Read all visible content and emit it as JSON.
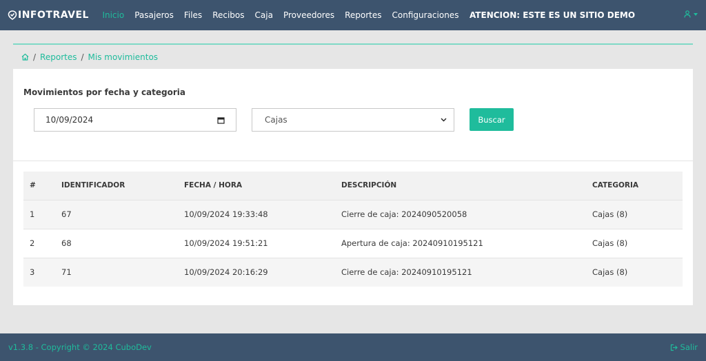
{
  "brand": {
    "name": "INFOTRAVEL"
  },
  "nav": {
    "items": [
      "Inicio",
      "Pasajeros",
      "Files",
      "Recibos",
      "Caja",
      "Proveedores",
      "Reportes",
      "Configuraciones"
    ],
    "warning": "ATENCION: ESTE ES UN SITIO DEMO"
  },
  "breadcrumb": {
    "items": [
      "Reportes",
      "Mis movimientos"
    ]
  },
  "panel": {
    "title": "Movimientos por fecha y categoria",
    "date_value": "10/09/2024",
    "category_value": "Cajas",
    "search_label": "Buscar"
  },
  "table": {
    "headers": [
      "#",
      "IDENTIFICADOR",
      "FECHA / HORA",
      "DESCRIPCIÓN",
      "CATEGORIA"
    ],
    "rows": [
      [
        "1",
        "67",
        "10/09/2024 19:33:48",
        "Cierre de caja: 2024090520058",
        "Cajas (8)"
      ],
      [
        "2",
        "68",
        "10/09/2024 19:51:21",
        "Apertura de caja: 20240910195121",
        "Cajas (8)"
      ],
      [
        "3",
        "71",
        "10/09/2024 20:16:29",
        "Cierre de caja: 20240910195121",
        "Cajas (8)"
      ]
    ]
  },
  "footer": {
    "copyright": "v1.3.8 - Copyright © 2024 CuboDev",
    "logout_label": "Salir"
  },
  "colors": {
    "accent": "#1fbc9c",
    "navbar": "#3d546e"
  }
}
